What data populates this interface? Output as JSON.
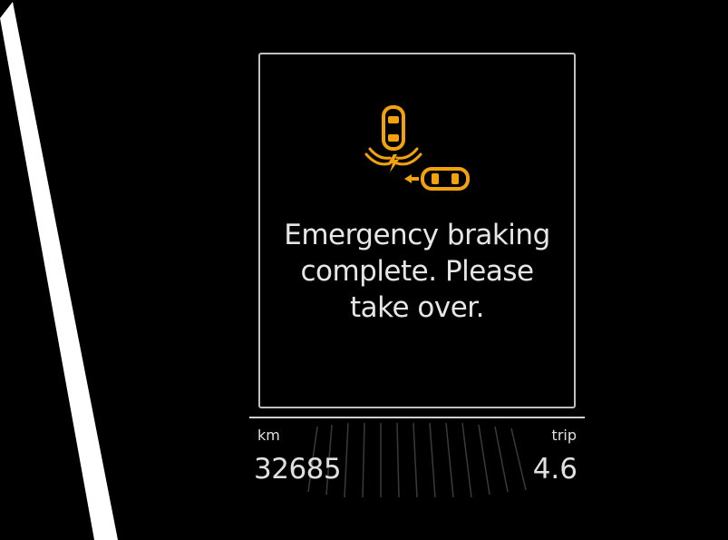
{
  "display": {
    "message_lines": [
      "Emergency braking",
      "complete. Please",
      "take over."
    ],
    "warning_icon": "emergency-braking-icon",
    "warning_color": "#f2a20c",
    "frame_color": "#bfbfbf",
    "text_color": "#e6e6e6"
  },
  "odometer": {
    "label": "km",
    "value": "32685"
  },
  "trip": {
    "label": "trip",
    "value": "4.6"
  }
}
